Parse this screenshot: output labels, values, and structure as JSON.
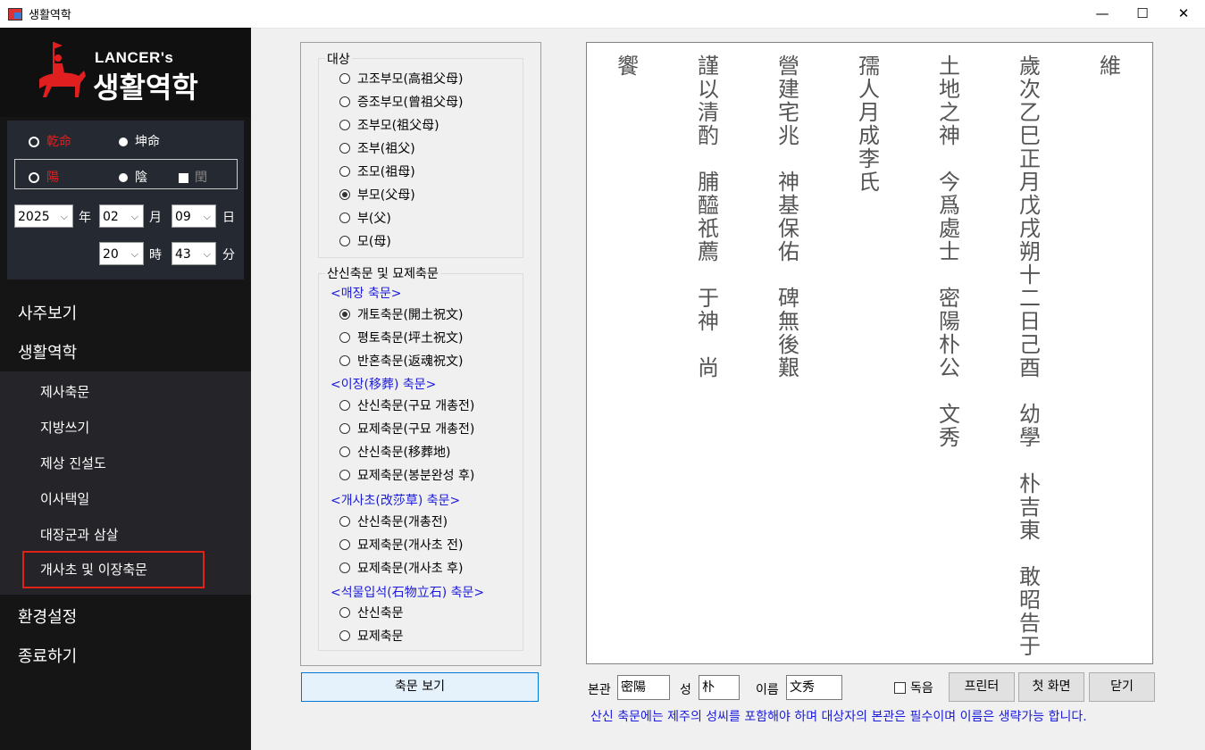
{
  "window": {
    "title": "생활역학",
    "minimize": "—",
    "maximize": "☐",
    "close": "✕"
  },
  "logo": {
    "top": "LANCER's",
    "main": "생활역학"
  },
  "birth": {
    "gender_male": "乾命",
    "gender_female": "坤命",
    "yang": "陽",
    "yin": "陰",
    "leap": "閏",
    "year": "2025",
    "year_unit": "年",
    "month": "02",
    "month_unit": "月",
    "day": "09",
    "day_unit": "日",
    "hour": "20",
    "hour_unit": "時",
    "minute": "43",
    "minute_unit": "分"
  },
  "menu": {
    "saju": "사주보기",
    "life": "생활역학",
    "sub": [
      "제사축문",
      "지방쓰기",
      "제상 진설도",
      "이사택일",
      "대장군과 삼살",
      "개사초 및 이장축문"
    ],
    "settings": "환경설정",
    "exit": "종료하기"
  },
  "target_group": {
    "legend": "대상",
    "options": [
      "고조부모(高祖父母)",
      "증조부모(曾祖父母)",
      "조부모(祖父母)",
      "조부(祖父)",
      "조모(祖母)",
      "부모(父母)",
      "부(父)",
      "모(母)"
    ],
    "selected": 5
  },
  "prayer_group": {
    "legend": "산신축문 및 묘제축문",
    "burial_header": "<매장 축문>",
    "burial": [
      "개토축문(開土祝文)",
      "평토축문(坪土祝文)",
      "반혼축문(返魂祝文)"
    ],
    "move_header": "<이장(移葬) 축문>",
    "move": [
      "산신축문(구묘 개총전)",
      "묘제축문(구묘 개총전)",
      "산신축문(移葬地)",
      "묘제축문(봉분완성 후)"
    ],
    "sod_header": "<개사초(改莎草) 축문>",
    "sod": [
      "산신축문(개총전)",
      "묘제축문(개사초 전)",
      "묘제축문(개사초 후)"
    ],
    "stone_header": "<석물입석(石物立石) 축문>",
    "stone": [
      "산신축문",
      "묘제축문"
    ]
  },
  "view_button": "축문 보기",
  "document": {
    "columns": [
      "維",
      "歲次乙巳正月戊戌朔十二日己酉　幼學　朴吉東　敢昭告于",
      "土地之神　今爲處士　密陽朴公　文秀",
      "孺人月成李氏",
      "營建宅兆　神基保佑　碑無後艱",
      "謹以清酌　脯醯祇薦　于神　尚",
      "饗"
    ]
  },
  "bottom": {
    "bongwan_label": "본관",
    "bongwan_value": "密陽",
    "surname_label": "성",
    "surname_value": "朴",
    "name_label": "이름",
    "name_value": "文秀",
    "solo_label": "독음",
    "print_button": "프린터",
    "home_button": "첫 화면",
    "close_button": "닫기",
    "note": "산신 축문에는 제주의 성씨를 포함해야 하며 대상자의 본관은 필수이며 이름은 생략가능 합니다."
  }
}
